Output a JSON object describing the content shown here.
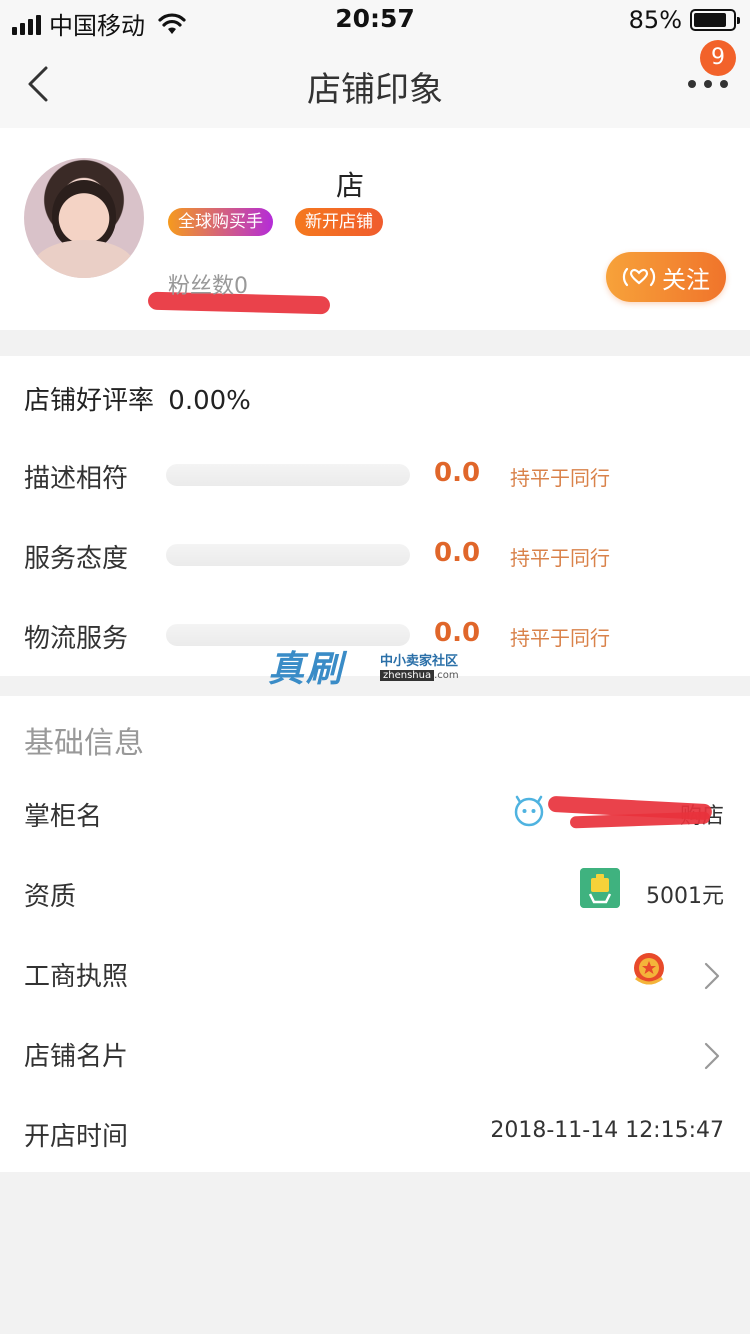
{
  "status_bar": {
    "carrier": "中国移动",
    "time": "20:57",
    "battery_percent": "85%",
    "battery_level": 0.85
  },
  "nav": {
    "title": "店铺印象",
    "badge_count": "9",
    "icons": {
      "back": "chevron-left-icon",
      "more": "more-dots-icon"
    }
  },
  "shop": {
    "name_visible_suffix": "店",
    "badges": [
      "全球购买手",
      "新开店铺"
    ],
    "fans": "粉丝数0",
    "follow_label": "关注",
    "colors": {
      "accent": "#f0742b",
      "score": "#e0662a"
    }
  },
  "ratings": {
    "title": "店铺好评率",
    "good_rate": "0.00%",
    "items": [
      {
        "label": "描述相符",
        "score": "0.0",
        "level": 0,
        "compare": "持平于同行"
      },
      {
        "label": "服务态度",
        "score": "0.0",
        "level": 0,
        "compare": "持平于同行"
      },
      {
        "label": "物流服务",
        "score": "0.0",
        "level": 0,
        "compare": "持平于同行"
      }
    ]
  },
  "watermark": {
    "main": "真刷",
    "sub": "中小卖家社区",
    "url_prefix": "zhenshua",
    "url_suffix": ".com"
  },
  "basic_info": {
    "title": "基础信息",
    "rows": [
      {
        "label": "掌柜名",
        "value": "购店"
      },
      {
        "label": "资质",
        "value": "5001元"
      },
      {
        "label": "工商执照",
        "value": ""
      },
      {
        "label": "店铺名片",
        "value": ""
      },
      {
        "label": "开店时间",
        "value": "2018-11-14 12:15:47"
      }
    ]
  }
}
